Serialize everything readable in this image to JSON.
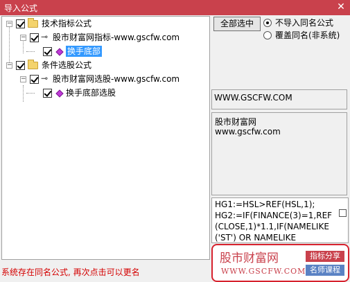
{
  "window": {
    "title": "导入公式",
    "close_glyph": "✕"
  },
  "tree": {
    "group1": {
      "label": "技术指标公式",
      "child": {
        "label": "股市财富网指标-www.gscfw.com",
        "leaf": "换手底部"
      }
    },
    "group2": {
      "label": "条件选股公式",
      "child": {
        "label": "股市财富网选股-www.gscfw.com",
        "leaf": "换手底部选股"
      }
    },
    "expander_glyph": "−",
    "key_glyph": "⊸"
  },
  "controls": {
    "select_all": "全部选中",
    "option_skip": "不导入同名公式",
    "option_overwrite": "覆盖同名(非系统)"
  },
  "info": {
    "url": "WWW.GSCFW.COM",
    "desc_lines": [
      "股市财富网",
      "www.gscfw.com"
    ],
    "code_lines": [
      "HG1:=HSL>REF(HSL,1);",
      "HG2:=IF(FINANCE(3)=1,REF",
      "(CLOSE,1)*1.1,IF(NAMELIKE",
      "('ST') OR NAMELIKE"
    ]
  },
  "status": "系统存在同名公式, 再次点击可以更名",
  "watermark": {
    "brand": "股市财富网",
    "site": "WWW.GSCFW.COM",
    "tag1": "指标分享",
    "tag2": "名师课程"
  },
  "colors": {
    "titlebar": "#c9414c",
    "selection": "#3399ff",
    "status": "#d40000",
    "ad_border": "#d6212d"
  }
}
